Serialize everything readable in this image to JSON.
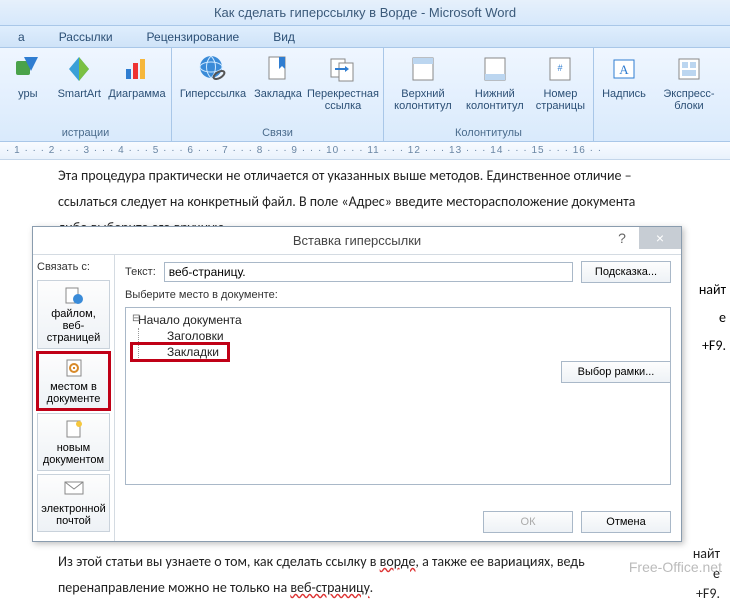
{
  "window": {
    "title": "Как сделать гиперссылку в Ворде - Microsoft Word"
  },
  "tabs": {
    "items": [
      "а",
      "Рассылки",
      "Рецензирование",
      "Вид"
    ]
  },
  "ribbon": {
    "illustrations": {
      "label": "истрации",
      "shapes": "уры",
      "smartart": "SmartArt",
      "chart": "Диаграмма"
    },
    "links": {
      "label": "Связи",
      "hyperlink": "Гиперссылка",
      "bookmark": "Закладка",
      "crossref": "Перекрестная ссылка"
    },
    "headerfooter": {
      "label": "Колонтитулы",
      "header": "Верхний колонтитул",
      "footer": "Нижний колонтитул",
      "pagenum": "Номер страницы"
    },
    "text": {
      "textbox": "Надпись",
      "quick": "Экспресс-блоки"
    }
  },
  "ruler": "· 1 · · · 2 · · · 3 · · · 4 · · · 5 · · · 6 · · · 7 · · · 8 · · · 9 · · · 10 · · · 11 · · · 12 · · · 13 · · · 14 · · · 15 · · · 16 · ·",
  "doc": {
    "p1a": "Эта процедура практически не отличается от указанных выше методов. Единственное отличие –",
    "p1b": "ссылаться следует на конкретный файл. В поле «Адрес» введите месторасположение документа",
    "p1c": "либо выберите его вручную.",
    "p2a": "найт",
    "p2b": "е",
    "p2c": "+F9.",
    "p3a": "Из этой статьи вы узнаете о том, как сделать ссылку в ",
    "p3w": "ворде",
    "p3b": ", а также ее вариациях, ведь",
    "p4a": "перенаправление можно не только на ",
    "p4w": "веб-страницу",
    "p4b": "."
  },
  "dialog": {
    "title": "Вставка гиперссылки",
    "linkwith": "Связать с:",
    "textlabel": "Текст:",
    "textvalue": "веб-страницу.",
    "hint": "Подсказка...",
    "selectplace": "Выберите место в документе:",
    "tree": {
      "root": "Начало документа",
      "headings": "Заголовки",
      "bookmarks": "Закладки"
    },
    "frame": "Выбор рамки...",
    "ok": "ОК",
    "cancel": "Отмена",
    "side": {
      "file": "файлом, веб-страницей",
      "place": "местом в документе",
      "newdoc": "новым документом",
      "email": "электронной почтой"
    }
  },
  "watermark": "Free-Office.net"
}
